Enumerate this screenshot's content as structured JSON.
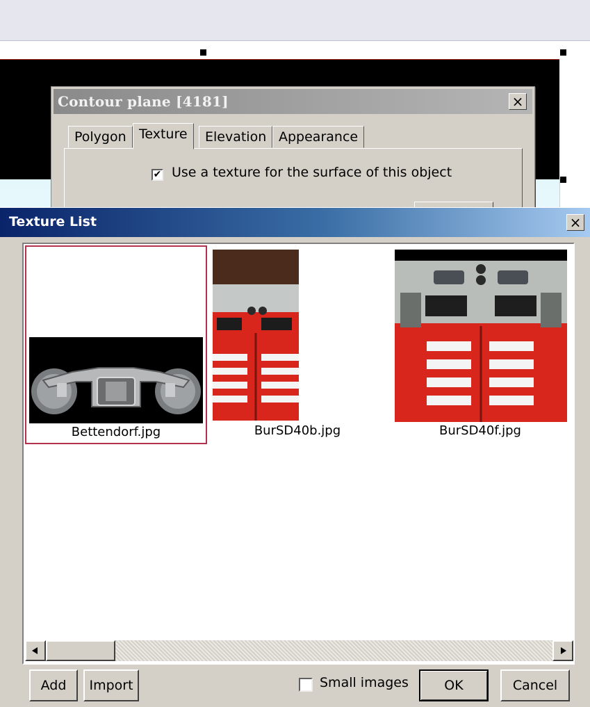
{
  "contour_dialog": {
    "title": "Contour plane [4181]",
    "close_glyph": "×",
    "tabs": [
      "Polygon",
      "Texture",
      "Elevation",
      "Appearance"
    ],
    "active_tab": "Texture",
    "use_texture_checked": true,
    "use_texture_label": "Use a texture for the surface of this object"
  },
  "texture_list": {
    "title": "Texture List",
    "close_glyph": "×",
    "items": [
      {
        "label": "Bettendorf.jpg",
        "selected": true
      },
      {
        "label": "BurSD40b.jpg",
        "selected": false
      },
      {
        "label": "BurSD40f.jpg",
        "selected": false
      }
    ],
    "small_images_checked": false,
    "small_images_label": "Small images",
    "add_label": "Add",
    "import_label": "Import",
    "ok_label": "OK",
    "cancel_label": "Cancel"
  },
  "colors": {
    "accent_titlebar": "#0a246a",
    "selection_border": "#b5304a",
    "locomotive_red": "#d8261c",
    "locomotive_gray": "#b8bdb9"
  },
  "icons": {
    "check": "check-icon",
    "scroll_left": "arrow-left-icon",
    "scroll_right": "arrow-right-icon",
    "close": "close-icon"
  }
}
